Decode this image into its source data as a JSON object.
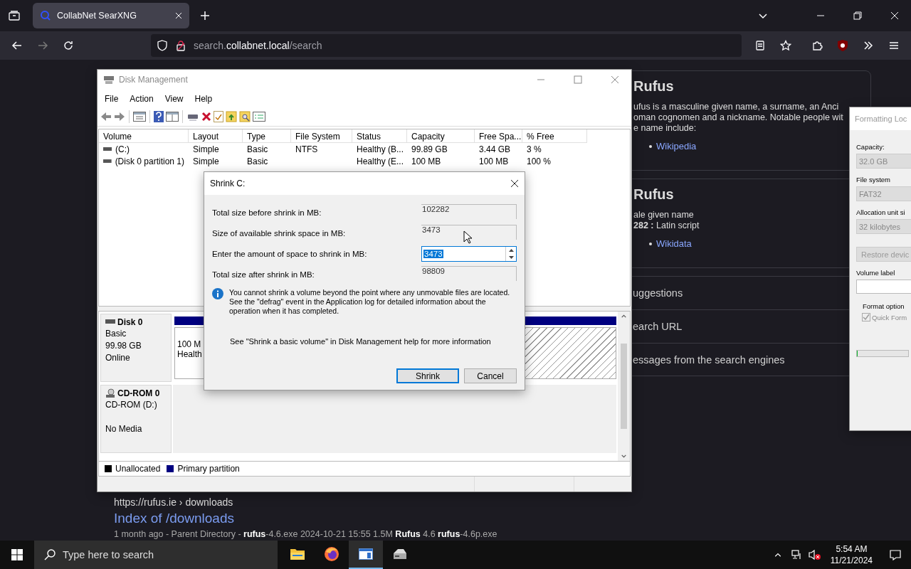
{
  "browser": {
    "tabs": [
      {
        "title": "CollabNet SearXNG",
        "selected": true
      }
    ],
    "forward_disabled": true,
    "url": {
      "subdomain": "search.",
      "domain": "collabnet.local",
      "path": "/search"
    }
  },
  "page": {
    "infobox": [
      {
        "heading": "Rufus",
        "lines": [
          "ufus is a masculine given name, a surname, an Anci",
          "oman cognomen and a nickname. Notable people wit",
          "e name include:"
        ],
        "links": [
          "Wikipedia"
        ]
      },
      {
        "heading": "Rufus",
        "lines": [
          "ale given name",
          "**282 :** Latin script"
        ],
        "links": [
          "Wikidata"
        ]
      }
    ],
    "sections": [
      "uggestions",
      "earch URL",
      "essages from the search engines"
    ],
    "result": {
      "url": "https://rufus.ie",
      "breadcrumb": "› downloads",
      "title": "Index of /downloads",
      "snippet": "1 month ago - Parent Directory - **rufus**-4.6.exe 2024-10-21 15:55 1.5M **Rufus** 4.6 **rufus**-4.6p.exe"
    }
  },
  "disk_management": {
    "title": "Disk Management",
    "menu": [
      "File",
      "Action",
      "View",
      "Help"
    ],
    "columns": [
      "Volume",
      "Layout",
      "Type",
      "File System",
      "Status",
      "Capacity",
      "Free Spa...",
      "% Free"
    ],
    "rows": [
      [
        "(C:)",
        "Simple",
        "Basic",
        "NTFS",
        "Healthy (B...",
        "99.89 GB",
        "3.44 GB",
        "3 %"
      ],
      [
        "(Disk 0 partition 1)",
        "Simple",
        "Basic",
        "",
        "Healthy (E...",
        "100 MB",
        "100 MB",
        "100 %"
      ]
    ],
    "disks": [
      {
        "kind": "disk",
        "name": "Disk 0",
        "type": "Basic",
        "size": "99.98 GB",
        "status": "Online",
        "partitions": [
          {
            "size": "100 M",
            "status": "Health",
            "selected": false
          },
          {
            "selected": true
          }
        ]
      },
      {
        "kind": "cdrom",
        "name": "CD-ROM 0",
        "type": "CD-ROM (D:)",
        "status": "No Media"
      }
    ],
    "legend": [
      {
        "label": "Unallocated",
        "color": "#000000"
      },
      {
        "label": "Primary partition",
        "color": "#000080"
      }
    ]
  },
  "shrink_dialog": {
    "title": "Shrink C:",
    "fields": [
      {
        "label": "Total size before shrink in MB:",
        "value": "102282",
        "kind": "readonly"
      },
      {
        "label": "Size of available shrink space in MB:",
        "value": "3473",
        "kind": "readonly"
      },
      {
        "label": "Enter the amount of space to shrink in MB:",
        "value": "3473",
        "kind": "spin",
        "selected": true
      },
      {
        "label": "Total size after shrink in MB:",
        "value": "98809",
        "kind": "readonly"
      }
    ],
    "info": "You cannot shrink a volume beyond the point where any unmovable files are located. See the \"defrag\" event in the Application log for detailed information about the operation when it has completed.",
    "help": "See \"Shrink a basic volume\" in Disk Management help for more information",
    "buttons": [
      {
        "label": "Shrink",
        "default": true
      },
      {
        "label": "Cancel",
        "default": false
      }
    ]
  },
  "rufus_window": {
    "title": "Formatting Loc",
    "items": [
      {
        "kind": "label",
        "text": "Capacity:"
      },
      {
        "kind": "select",
        "value": "32.0 GB",
        "disabled": true
      },
      {
        "kind": "label",
        "text": "File system"
      },
      {
        "kind": "select",
        "value": "FAT32",
        "disabled": true
      },
      {
        "kind": "label",
        "text": "Allocation unit si"
      },
      {
        "kind": "select",
        "value": "32 kilobytes",
        "disabled": true
      },
      {
        "kind": "button",
        "text": "Restore devic",
        "disabled": true
      },
      {
        "kind": "label",
        "text": "Volume label"
      },
      {
        "kind": "input",
        "disabled": false
      },
      {
        "kind": "group",
        "text": "Format option"
      },
      {
        "kind": "checkbox",
        "text": "Quick Form",
        "checked": true,
        "disabled": true
      },
      {
        "kind": "progress",
        "level": 0
      }
    ]
  },
  "taskbar": {
    "search_placeholder": "Type here to search",
    "apps": [
      {
        "kind": "folder",
        "active": false
      },
      {
        "kind": "browser",
        "active": false
      },
      {
        "kind": "disk",
        "active": true
      },
      {
        "kind": "drive",
        "active": false
      }
    ],
    "time": "5:54 AM",
    "date": "11/21/2024"
  }
}
